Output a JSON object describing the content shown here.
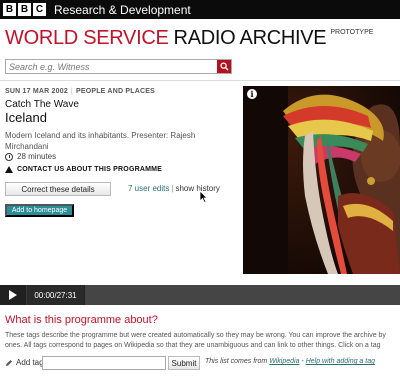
{
  "topbar": {
    "logo_letters": [
      "B",
      "B",
      "C"
    ],
    "section_title": "Research & Development"
  },
  "header": {
    "title_red": "WORLD SERVICE",
    "title_black": "RADIO ARCHIVE",
    "badge": "PROTOTYPE"
  },
  "search": {
    "placeholder": "Search e.g. Witness",
    "icon": "search-icon"
  },
  "programme": {
    "date": "SUN 17 MAR 2002",
    "category": "PEOPLE AND PLACES",
    "series": "Catch The Wave",
    "title": "Iceland",
    "description": "Modern Iceland and its inhabitants. Presenter: Rajesh Mirchandani",
    "duration": "28 minutes",
    "contact_label": "CONTACT US ABOUT THIS PROGRAMME"
  },
  "actions": {
    "correct_label": "Correct these details",
    "edits_count": "7 user edits",
    "history_label": "show history",
    "homepage_label": "Add to homepage"
  },
  "image": {
    "info_label": "i"
  },
  "player": {
    "time": "00:00/27:31"
  },
  "tags": {
    "heading": "What is this programme about?",
    "description_1": "These tags describe the programme but were created automatically so they may be wrong. You can improve the archive by",
    "description_2": "ones. All tags correspond to pages on Wikipedia so that they are unambiguous and can link to other things. Click on a tag",
    "add_label": "Add tag",
    "submit_label": "Submit",
    "note_prefix": "This list comes from",
    "note_link1": "Wikipedia",
    "note_sep": " - ",
    "note_link2": "Help with adding a tag"
  },
  "colors": {
    "brand_red": "#c0132a",
    "teal_button": "#2a8d97",
    "search_button": "#b4111f"
  }
}
